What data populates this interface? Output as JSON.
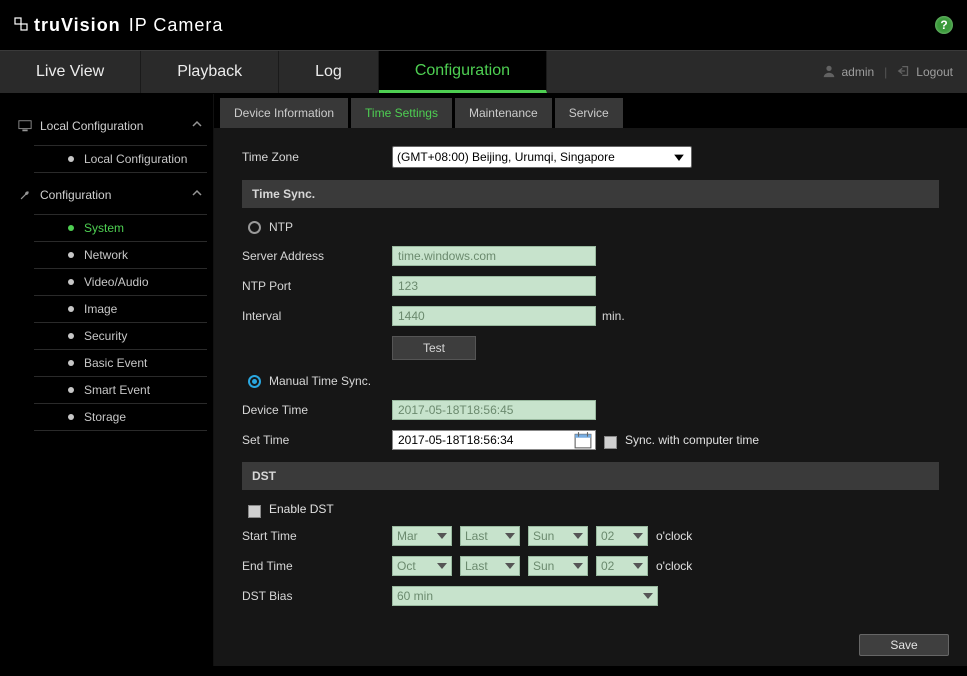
{
  "brand": {
    "logo": "truVision",
    "product": "IP Camera"
  },
  "nav": {
    "items": [
      "Live View",
      "Playback",
      "Log",
      "Configuration"
    ],
    "active": "Configuration"
  },
  "user": {
    "name": "admin",
    "logout": "Logout"
  },
  "sidebar": {
    "group1": {
      "title": "Local Configuration",
      "items": [
        "Local Configuration"
      ]
    },
    "group2": {
      "title": "Configuration",
      "items": [
        "System",
        "Network",
        "Video/Audio",
        "Image",
        "Security",
        "Basic Event",
        "Smart Event",
        "Storage"
      ],
      "active": "System"
    }
  },
  "tabs": {
    "items": [
      "Device Information",
      "Time Settings",
      "Maintenance",
      "Service"
    ],
    "active": "Time Settings"
  },
  "form": {
    "timezone_label": "Time Zone",
    "timezone_value": "(GMT+08:00) Beijing, Urumqi, Singapore",
    "timesync_header": "Time Sync.",
    "ntp_label": "NTP",
    "server_address_label": "Server Address",
    "server_address_value": "time.windows.com",
    "ntp_port_label": "NTP Port",
    "ntp_port_value": "123",
    "interval_label": "Interval",
    "interval_value": "1440",
    "interval_unit": "min.",
    "test_label": "Test",
    "manual_label": "Manual Time Sync.",
    "device_time_label": "Device Time",
    "device_time_value": "2017-05-18T18:56:45",
    "set_time_label": "Set Time",
    "set_time_value": "2017-05-18T18:56:34",
    "sync_computer_label": "Sync. with computer time",
    "dst_header": "DST",
    "enable_dst_label": "Enable DST",
    "start_time_label": "Start Time",
    "end_time_label": "End Time",
    "oclock": "o'clock",
    "start": {
      "month": "Mar",
      "week": "Last",
      "day": "Sun",
      "hour": "02"
    },
    "end": {
      "month": "Oct",
      "week": "Last",
      "day": "Sun",
      "hour": "02"
    },
    "dst_bias_label": "DST Bias",
    "dst_bias_value": "60 min",
    "save_label": "Save"
  }
}
